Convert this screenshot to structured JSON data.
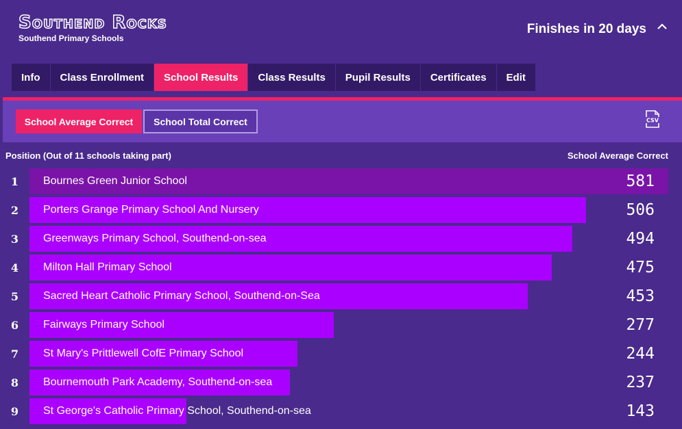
{
  "brand": {
    "title": "Southend Rocks",
    "subtitle": "Southend Primary Schools"
  },
  "countdown": "Finishes in 20 days",
  "tabs": [
    {
      "label": "Info",
      "active": false
    },
    {
      "label": "Class Enrollment",
      "active": false
    },
    {
      "label": "School Results",
      "active": true
    },
    {
      "label": "Class Results",
      "active": false
    },
    {
      "label": "Pupil Results",
      "active": false
    },
    {
      "label": "Certificates",
      "active": false
    },
    {
      "label": "Edit",
      "active": false
    }
  ],
  "toggles": {
    "average": "School Average Correct",
    "total": "School Total Correct"
  },
  "csv_label": "CSV",
  "list": {
    "position_header": "Position (Out of 11 schools taking part)",
    "score_header": "School Average Correct",
    "max_score": 581,
    "rows": [
      {
        "position": "1",
        "school": "Bournes Green Junior School",
        "score": 581
      },
      {
        "position": "2",
        "school": "Porters Grange Primary School And Nursery",
        "score": 506
      },
      {
        "position": "3",
        "school": "Greenways Primary School, Southend-on-sea",
        "score": 494
      },
      {
        "position": "4",
        "school": "Milton Hall Primary School",
        "score": 475
      },
      {
        "position": "5",
        "school": "Sacred Heart Catholic Primary School, Southend-on-Sea",
        "score": 453
      },
      {
        "position": "6",
        "school": "Fairways Primary School",
        "score": 277
      },
      {
        "position": "7",
        "school": "St Mary's Prittlewell CofE Primary School",
        "score": 244
      },
      {
        "position": "8",
        "school": "Bournemouth Park Academy, Southend-on-sea",
        "score": 237
      },
      {
        "position": "9",
        "school": "St George's Catholic Primary School, Southend-on-sea",
        "score": 143
      }
    ]
  },
  "colors": {
    "background": "#4a2a8c",
    "accent": "#ee2266",
    "bar": "#aa00ff",
    "bar_top": "#7a14a8",
    "toolbar": "#6a40b8"
  }
}
